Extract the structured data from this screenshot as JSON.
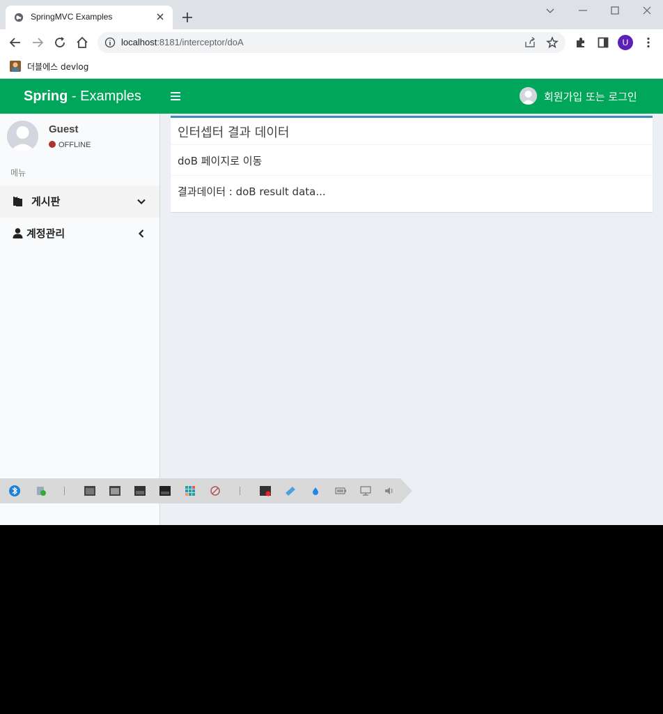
{
  "browser": {
    "tab_title": "SpringMVC Examples",
    "url_host": "localhost",
    "url_path": ":8181/interceptor/doA",
    "profile_initial": "U",
    "bookmark_label": "더블에스 devlog"
  },
  "header": {
    "brand_bold": "Spring",
    "brand_rest": " - Examples",
    "user_link": "회원가입 또는 로그인"
  },
  "sidebar": {
    "user_name": "Guest",
    "user_status": "OFFLINE",
    "menu_header": "메뉴",
    "items": [
      {
        "label": "게시판",
        "icon": "clipboard-icon",
        "arrow": "chevron-down-icon"
      },
      {
        "label": "계정관리",
        "icon": "user-icon",
        "arrow": "chevron-left-icon"
      }
    ]
  },
  "main": {
    "box_title": "인터셉터 결과 데이터",
    "link_text": "doB 페이지로 이동",
    "result_text": "결과데이터 : doB result data..."
  },
  "colors": {
    "brand_green": "#00a65a",
    "box_border": "#3c8dbc",
    "offline_dot": "#aa3333"
  }
}
